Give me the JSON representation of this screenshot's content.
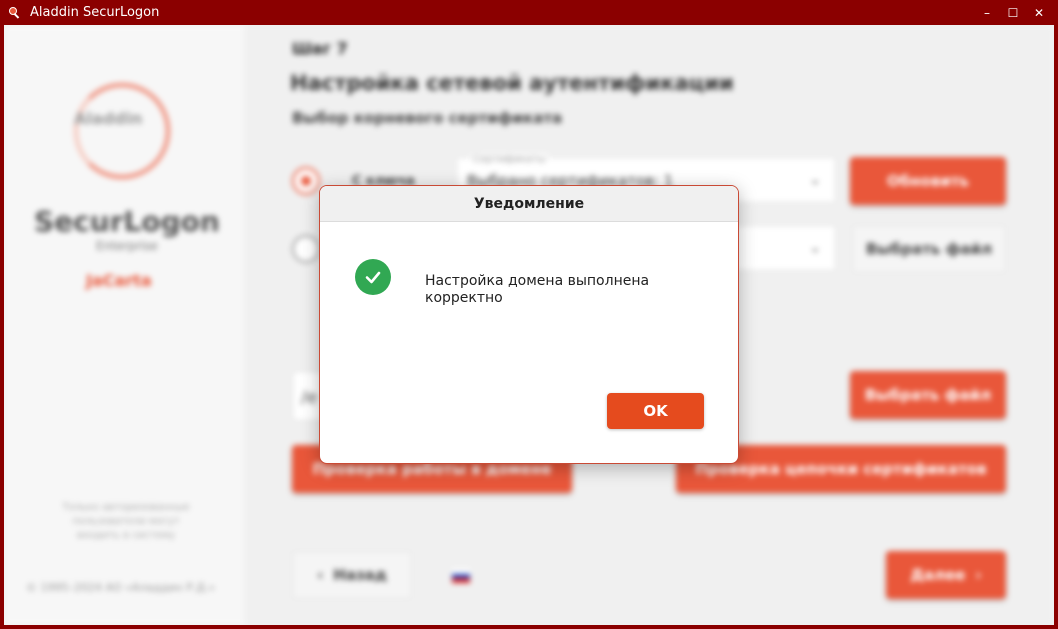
{
  "window": {
    "title": "Aladdin SecurLogon",
    "controls": {
      "minimize": "–",
      "maximize": "☐",
      "close": "✕"
    }
  },
  "sidebar": {
    "logo_text": "Aladdin",
    "brand": "SecurLogon",
    "edition": "Enterprise",
    "product": "JaCarta",
    "note": "Только авторизованные пользователи могут входить в систему",
    "copyright": "© 1995–2024 АО «Аладдин Р.Д.»"
  },
  "main": {
    "step": "Шаг 7",
    "title": "Настройка сетевой аутентификации",
    "subtitle": "Выбор корневого сертификата",
    "option_key": {
      "label": "С ключа",
      "field_legend": "Сертификаты",
      "field_value": "Выбрано сертификатов: 1",
      "button": "Обновить"
    },
    "option_file": {
      "button": "Выбрать файл"
    },
    "path": {
      "value": "/e",
      "button": "Выбрать файл"
    },
    "check_domain_button": "Проверка работы в домене",
    "check_chain_button": "Проверка цепочки сертификатов",
    "back_button": "Назад",
    "next_button": "Далее"
  },
  "dialog": {
    "title": "Уведомление",
    "message": "Настройка домена выполнена корректно",
    "ok_button": "OK"
  },
  "colors": {
    "frame": "#8b0000",
    "accent": "#e9573a",
    "success": "#31a853"
  }
}
